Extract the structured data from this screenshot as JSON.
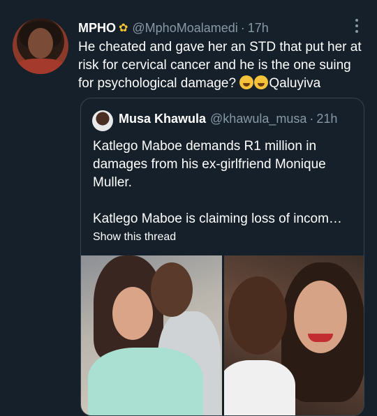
{
  "tweet": {
    "display_name": "MPHO",
    "handle": "@MphoMoalamedi",
    "separator": "·",
    "time": "17h",
    "text": "He cheated and gave her an STD that put her at risk for cervical cancer and he is the one suing for psychological damage?",
    "text_suffix": "Qaluyiva",
    "emoji_count": 2,
    "name_badge_icon": "sunflower-icon"
  },
  "quoted_tweet": {
    "display_name": "Musa Khawula",
    "handle": "@khawula_musa",
    "separator": "·",
    "time": "21h",
    "paragraph1": "Katlego Maboe demands R1 million in damages from his ex-girlfriend Monique Muller.",
    "paragraph2": "Katlego Maboe is claiming loss of incom…",
    "show_thread": "Show this thread",
    "photo_count": 2
  },
  "colors": {
    "background": "#15202b",
    "text_primary": "#ffffff",
    "text_secondary": "#8899a6",
    "border": "#38444d"
  }
}
